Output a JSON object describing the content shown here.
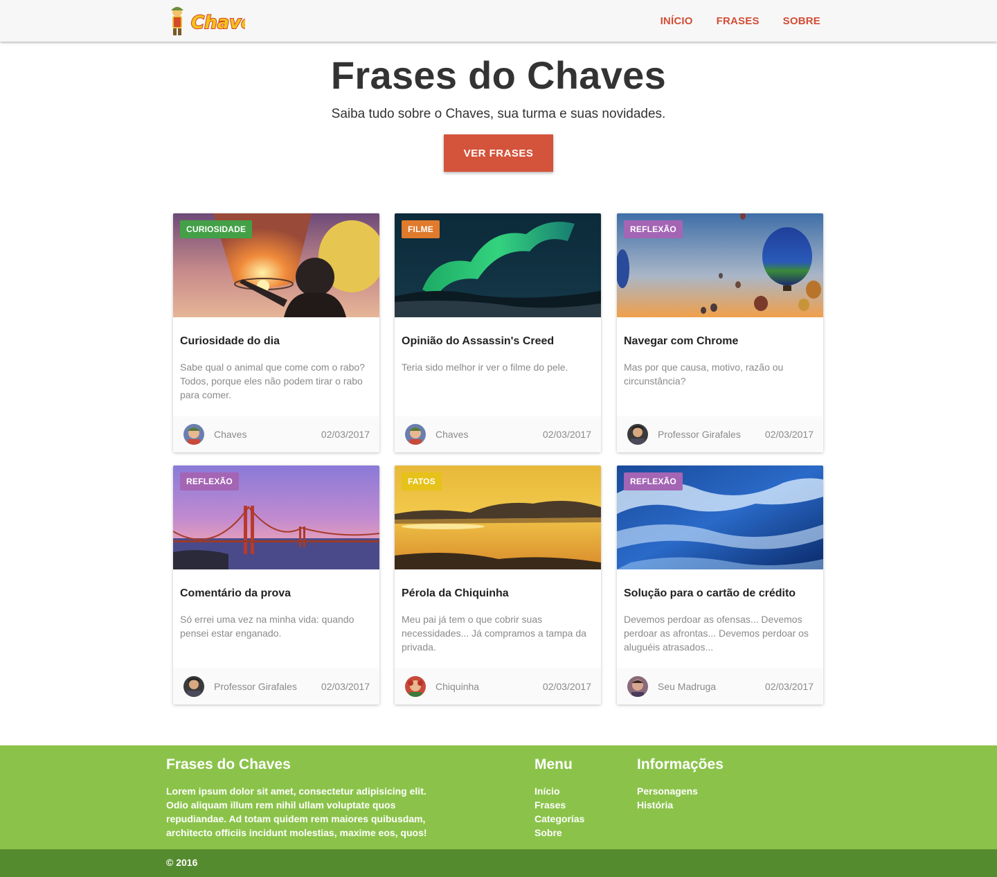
{
  "header": {
    "logo_text": "Chaves",
    "nav": [
      "INÍCIO",
      "FRASES",
      "SOBRE"
    ]
  },
  "hero": {
    "title": "Frases do Chaves",
    "subtitle": "Saiba tudo sobre o Chaves, sua turma e suas novidades.",
    "button": "VER FRASES"
  },
  "colors": {
    "accent": "#d4533b",
    "curiosidade": "#43a047",
    "filme": "#e07a2c",
    "reflexao": "#a465b5",
    "fatos": "#e6c21a",
    "footer": "#8bc34a",
    "footer_bottom": "#558b2f"
  },
  "cards": [
    {
      "tag": "CURIOSIDADE",
      "tag_color": "#43a047",
      "image": "lanterns-photo",
      "title": "Curiosidade do dia",
      "text": "Sabe qual o animal que come com o rabo? Todos, porque eles não podem tirar o rabo para comer.",
      "author": "Chaves",
      "date": "02/03/2017"
    },
    {
      "tag": "FILME",
      "tag_color": "#e07a2c",
      "image": "aurora-photo",
      "title": "Opinião do Assassin's Creed",
      "text": "Teria sido melhor ir ver o filme do pele.",
      "author": "Chaves",
      "date": "02/03/2017"
    },
    {
      "tag": "REFLEXÃO",
      "tag_color": "#a465b5",
      "image": "balloons-photo",
      "title": "Navegar com Chrome",
      "text": "Mas por que causa, motivo, razão ou circunstância?",
      "author": "Professor Girafales",
      "date": "02/03/2017"
    },
    {
      "tag": "REFLEXÃO",
      "tag_color": "#a465b5",
      "image": "bridge-photo",
      "title": "Comentário da prova",
      "text": "Só errei uma vez na minha vida: quando pensei estar enganado.",
      "author": "Professor Girafales",
      "date": "02/03/2017"
    },
    {
      "tag": "FATOS",
      "tag_color": "#e6c21a",
      "image": "sunset-lake-photo",
      "title": "Pérola da Chiquinha",
      "text": "Meu pai já tem o que cobrir suas necessidades... Já compramos a tampa da privada.",
      "author": "Chiquinha",
      "date": "02/03/2017"
    },
    {
      "tag": "REFLEXÃO",
      "tag_color": "#a465b5",
      "image": "ocean-waves-photo",
      "title": "Solução para o cartão de crédito",
      "text": "Devemos perdoar as ofensas... Devemos perdoar as afrontas... Devemos perdoar os aluguéis atrasados...",
      "author": "Seu Madruga",
      "date": "02/03/2017"
    }
  ],
  "footer": {
    "title": "Frases do Chaves",
    "text": "Lorem ipsum dolor sit amet, consectetur adipisicing elit. Odio aliquam illum rem nihil ullam voluptate quos repudiandae. Ad totam quidem rem maiores quibusdam, architecto officiis incidunt molestias, maxime eos, quos!",
    "menu_title": "Menu",
    "menu": [
      "Início",
      "Frases",
      "Categorías",
      "Sobre"
    ],
    "info_title": "Informações",
    "info": [
      "Personagens",
      "História"
    ],
    "copyright": "© 2016"
  }
}
